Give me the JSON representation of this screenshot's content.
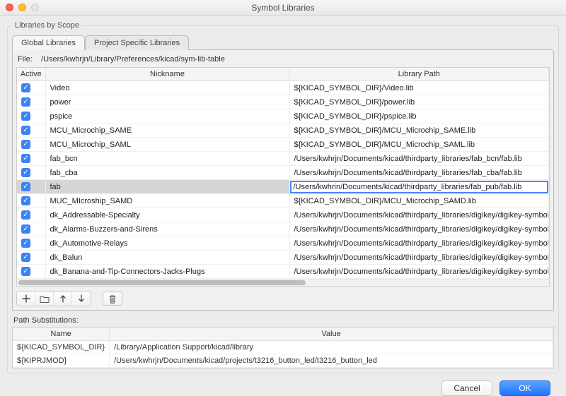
{
  "window": {
    "title": "Symbol Libraries"
  },
  "scope": {
    "legend": "Libraries by Scope",
    "tabs": [
      {
        "label": "Global Libraries",
        "active": true
      },
      {
        "label": "Project Specific Libraries",
        "active": false
      }
    ],
    "file_label": "File:",
    "file_path": "/Users/kwhrjn/Library/Preferences/kicad/sym-lib-table",
    "columns": {
      "active": "Active",
      "nickname": "Nickname",
      "path": "Library Path"
    },
    "rows": [
      {
        "active": true,
        "nickname": "Video",
        "path": "${KICAD_SYMBOL_DIR}/Video.lib",
        "selected": false
      },
      {
        "active": true,
        "nickname": "power",
        "path": "${KICAD_SYMBOL_DIR}/power.lib",
        "selected": false
      },
      {
        "active": true,
        "nickname": "pspice",
        "path": "${KICAD_SYMBOL_DIR}/pspice.lib",
        "selected": false
      },
      {
        "active": true,
        "nickname": "MCU_Microchip_SAME",
        "path": "${KICAD_SYMBOL_DIR}/MCU_Microchip_SAME.lib",
        "selected": false
      },
      {
        "active": true,
        "nickname": "MCU_Microchip_SAML",
        "path": "${KICAD_SYMBOL_DIR}/MCU_Microchip_SAML.lib",
        "selected": false
      },
      {
        "active": true,
        "nickname": "fab_bcn",
        "path": "/Users/kwhrjn/Documents/kicad/thirdparty_libraries/fab_bcn/fab.lib",
        "selected": false
      },
      {
        "active": true,
        "nickname": "fab_cba",
        "path": "/Users/kwhrjn/Documents/kicad/thirdparty_libraries/fab_cba/fab.lib",
        "selected": false
      },
      {
        "active": true,
        "nickname": "fab",
        "path": "/Users/kwhrin/Documents/kicad/thirdparty_libraries/fab_pub/fab.lib",
        "selected": true,
        "editing": true
      },
      {
        "active": true,
        "nickname": "MUC_MIcroship_SAMD",
        "path": "${KICAD_SYMBOL_DIR}/MCU_Microchip_SAMD.lib",
        "selected": false
      },
      {
        "active": true,
        "nickname": "dk_Addressable-Specialty",
        "path": "/Users/kwhrjn/Documents/kicad/thirdparty_libraries/digikey/digikey-symbols/dk_Addressable-Specialty.lib",
        "selected": false
      },
      {
        "active": true,
        "nickname": "dk_Alarms-Buzzers-and-Sirens",
        "path": "/Users/kwhrjn/Documents/kicad/thirdparty_libraries/digikey/digikey-symbols/dk_Alarms-Buzzers-and-Sirens.lib",
        "selected": false
      },
      {
        "active": true,
        "nickname": "dk_Automotive-Relays",
        "path": "/Users/kwhrjn/Documents/kicad/thirdparty_libraries/digikey/digikey-symbols/dk_Automotive-Relays.lib",
        "selected": false
      },
      {
        "active": true,
        "nickname": "dk_Balun",
        "path": "/Users/kwhrjn/Documents/kicad/thirdparty_libraries/digikey/digikey-symbols/dk_Balun.lib",
        "selected": false
      },
      {
        "active": true,
        "nickname": "dk_Banana-and-Tip-Connectors-Jacks-Plugs",
        "path": "/Users/kwhrjn/Documents/kicad/thirdparty_libraries/digikey/digikey-symbols/dk_Banana-and-Tip-Connectors-Jacks-Plugs.lib",
        "selected": false
      }
    ],
    "toolbar": {
      "add": "+",
      "folder": "▭",
      "up": "↑",
      "down": "↓",
      "trash": "🗑"
    }
  },
  "subs": {
    "label": "Path Substitutions:",
    "columns": {
      "name": "Name",
      "value": "Value"
    },
    "rows": [
      {
        "name": "${KICAD_SYMBOL_DIR}",
        "value": "/Library/Application Support/kicad/library"
      },
      {
        "name": "${KIPRJMOD}",
        "value": "/Users/kwhrjn/Documents/kicad/projects/t3216_button_led/t3216_button_led"
      }
    ]
  },
  "footer": {
    "cancel": "Cancel",
    "ok": "OK"
  }
}
